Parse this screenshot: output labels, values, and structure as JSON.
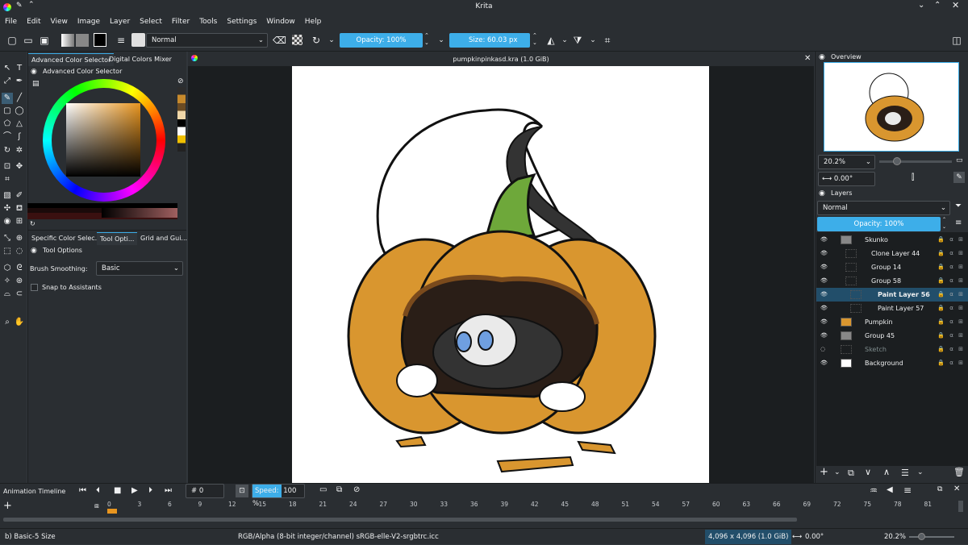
{
  "window": {
    "title": "Krita"
  },
  "menu": [
    "File",
    "Edit",
    "View",
    "Image",
    "Layer",
    "Select",
    "Filter",
    "Tools",
    "Settings",
    "Window",
    "Help"
  ],
  "toolbar": {
    "blend_mode": "Normal",
    "opacity": "Opacity: 100%",
    "size": "Size: 60.03 px"
  },
  "left_docker": {
    "tabs": [
      "Advanced Color Selector",
      "Digital Colors Mixer"
    ],
    "header": "Advanced Color Selector",
    "bottom_tabs": [
      "Specific Color Selec...",
      "Tool Opti...",
      "Grid and Gui..."
    ],
    "tool_options_title": "Tool Options",
    "brush_smoothing_label": "Brush Smoothing:",
    "brush_smoothing_value": "Basic",
    "snap_label": "Snap to Assistants"
  },
  "document": {
    "title": "pumpkinpinkasd.kra (1.0 GiB)"
  },
  "overview": {
    "title": "Overview",
    "zoom": "20.2%",
    "rotation": "0.00°"
  },
  "layers": {
    "title": "Layers",
    "blend": "Normal",
    "opacity": "Opacity:  100%",
    "items": [
      {
        "name": "Skunko",
        "indent": 0,
        "selected": false
      },
      {
        "name": "Clone Layer 44",
        "indent": 1,
        "selected": false
      },
      {
        "name": "Group 14",
        "indent": 1,
        "selected": false
      },
      {
        "name": "Group 58",
        "indent": 1,
        "selected": false
      },
      {
        "name": "Paint Layer 56",
        "indent": 2,
        "selected": true
      },
      {
        "name": "Paint Layer 57",
        "indent": 2,
        "selected": false
      },
      {
        "name": "Pumpkin",
        "indent": 0,
        "selected": false
      },
      {
        "name": "Group 45",
        "indent": 0,
        "selected": false
      },
      {
        "name": "Sketch",
        "indent": 0,
        "selected": false
      },
      {
        "name": "Background",
        "indent": 0,
        "selected": false
      }
    ]
  },
  "timeline": {
    "title": "Animation Timeline",
    "frame": "# 0",
    "speed_label": "Speed:",
    "speed_value": "100 %",
    "ticks": [
      "0",
      "3",
      "6",
      "9",
      "12",
      "15",
      "18",
      "21",
      "24",
      "27",
      "30",
      "33",
      "36",
      "39",
      "42",
      "45",
      "48",
      "51",
      "54",
      "57",
      "60",
      "63",
      "66",
      "69",
      "72",
      "75",
      "78",
      "81"
    ]
  },
  "status": {
    "brush": "b) Basic-5 Size",
    "color_space": "RGB/Alpha (8-bit integer/channel)  sRGB-elle-V2-srgbtrc.icc",
    "dimensions": "4,096 x 4,096 (1.0 GiB)",
    "rotation": "0.00°",
    "zoom": "20.2%"
  },
  "colors": {
    "accent": "#3daee9",
    "pumpkin": "#d9962f",
    "stem": "#6ea83a",
    "selected_layer": "#224e6a"
  }
}
